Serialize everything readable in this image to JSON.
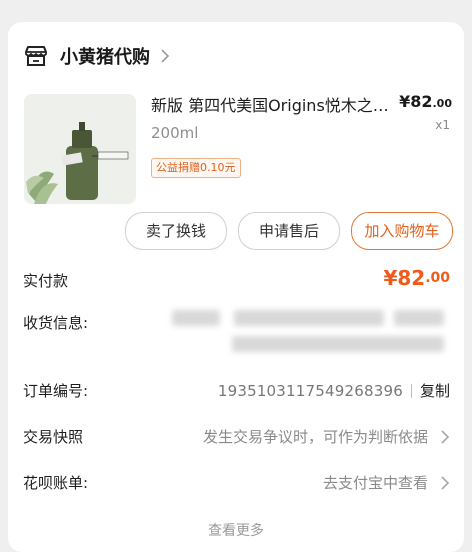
{
  "shop": {
    "name": "小黄猪代购",
    "icon": "store-icon"
  },
  "product": {
    "title": "新版 第四代美国Origins悦木之源韦博士灵芝焕能精华水",
    "price_main": "¥82",
    "price_decimal": ".00",
    "quantity": "x1",
    "spec": "200ml",
    "charity_tag": "公益捐赠0.10元"
  },
  "actions": {
    "exchange_label": "卖了换钱",
    "aftersale_label": "申请售后",
    "cart_label": "加入购物车"
  },
  "details": {
    "paid_label": "实付款",
    "paid_main": "¥82",
    "paid_decimal": ".00",
    "shipping_label": "收货信息:",
    "order_label": "订单编号:",
    "order_number": "1935103117549268396",
    "copy_label": "复制",
    "snapshot_label": "交易快照",
    "snapshot_value": "发生交易争议时，可作为判断依据",
    "huabei_label": "花呗账单:",
    "huabei_value": "去支付宝中查看",
    "more_label": "查看更多"
  },
  "colors": {
    "accent": "#f05a1a",
    "card": "#ffffff",
    "background": "#efefef"
  }
}
